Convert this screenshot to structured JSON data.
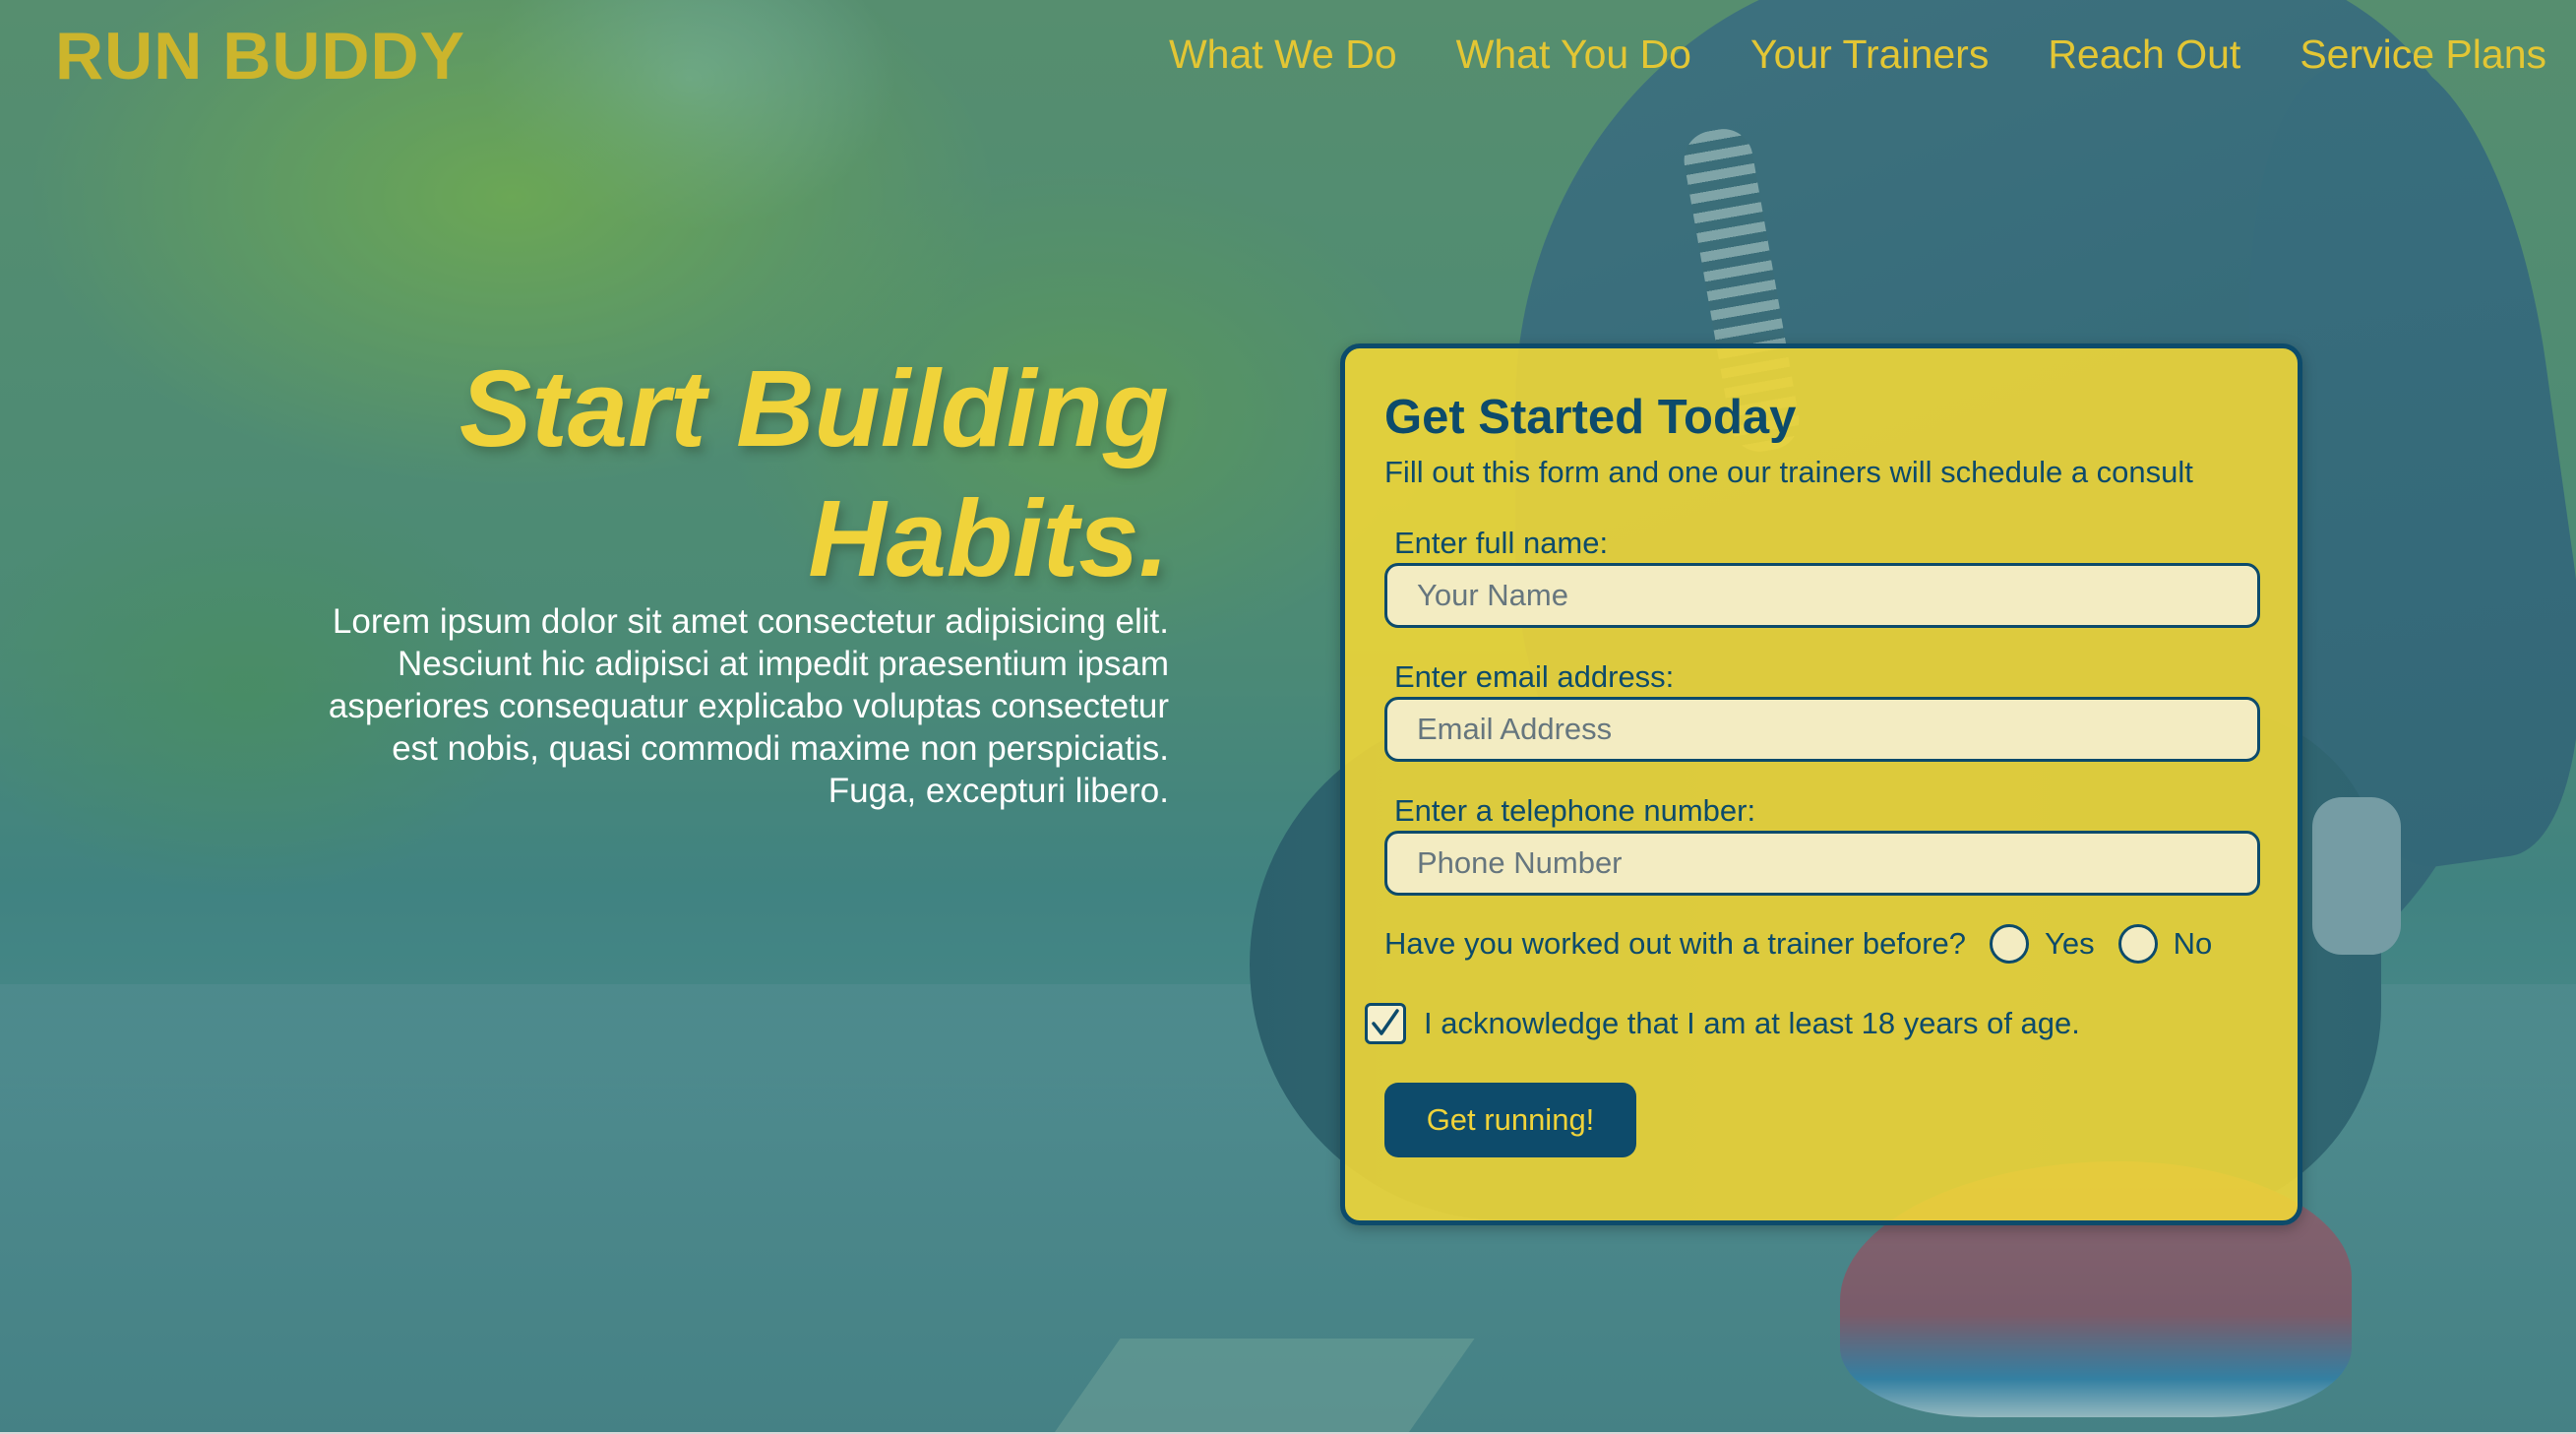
{
  "brand": "RUN BUDDY",
  "nav": [
    {
      "label": "What We Do"
    },
    {
      "label": "What You Do"
    },
    {
      "label": "Your Trainers"
    },
    {
      "label": "Reach Out"
    },
    {
      "label": "Service Plans"
    }
  ],
  "hero": {
    "title": "Start Building Habits.",
    "text": "Lorem ipsum dolor sit amet consectetur adipisicing elit. Nesciunt hic adipisci at impedit praesentium ipsam asperiores consequatur explicabo voluptas consectetur est nobis, quasi commodi maxime non perspiciatis. Fuga, excepturi libero."
  },
  "form": {
    "title": "Get Started Today",
    "description": "Fill out this form and one our trainers will schedule a consult",
    "name_label": "Enter full name:",
    "name_placeholder": "Your Name",
    "name_value": "",
    "email_label": "Enter email address:",
    "email_placeholder": "Email Address",
    "email_value": "",
    "phone_label": "Enter a telephone number:",
    "phone_placeholder": "Phone Number",
    "phone_value": "",
    "trainer_question": "Have you worked out with a trainer before?",
    "yes_label": "Yes",
    "no_label": "No",
    "acknowledge_label": "I acknowledge that I am at least 18 years of age.",
    "acknowledge_checked": true,
    "submit_label": "Get running!"
  },
  "colors": {
    "brand_yellow": "#ccb52c",
    "accent_yellow": "#f0d33a",
    "navy": "#0d4b6b",
    "overlay_teal": "#276e78"
  }
}
